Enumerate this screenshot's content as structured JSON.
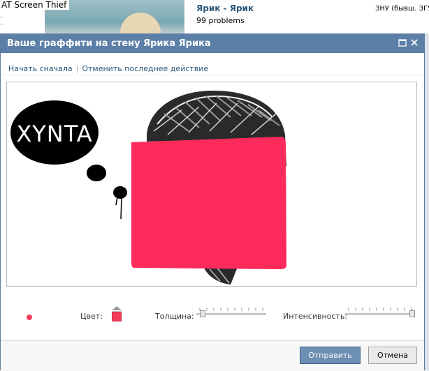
{
  "overlay": {
    "label": "AT Screen Thief"
  },
  "background": {
    "profile_name": "Ярик - Ярик",
    "profile_status": "99 problems",
    "right_text": "ЗНУ (бывш. ЗГУ"
  },
  "dialog": {
    "title": "Ваше граффити на стену Ярика Ярика",
    "toolbar": {
      "restart": "Начать сначала",
      "undo": "Отменить последнее действие"
    },
    "canvas": {
      "bubble_text": "XYNTA",
      "brush_color": "#fe2a5b"
    },
    "controls": {
      "color_label": "Цвет:",
      "color_value": "#f23b5b",
      "thickness_label": "Толщина:",
      "thickness_value": 0.05,
      "intensity_label": "Интенсивность:",
      "intensity_value": 1.0
    },
    "buttons": {
      "send": "Отправить",
      "cancel": "Отмена"
    }
  },
  "colors": {
    "titlebar": "#5b7fa6",
    "link": "#2b587a",
    "accent_pink": "#f23b5b"
  }
}
